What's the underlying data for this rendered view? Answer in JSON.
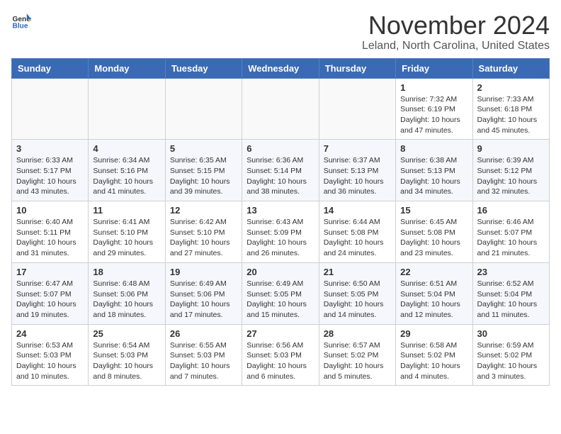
{
  "header": {
    "logo_general": "General",
    "logo_blue": "Blue",
    "month_year": "November 2024",
    "location": "Leland, North Carolina, United States"
  },
  "days_of_week": [
    "Sunday",
    "Monday",
    "Tuesday",
    "Wednesday",
    "Thursday",
    "Friday",
    "Saturday"
  ],
  "weeks": [
    [
      {
        "day": "",
        "info": ""
      },
      {
        "day": "",
        "info": ""
      },
      {
        "day": "",
        "info": ""
      },
      {
        "day": "",
        "info": ""
      },
      {
        "day": "",
        "info": ""
      },
      {
        "day": "1",
        "info": "Sunrise: 7:32 AM\nSunset: 6:19 PM\nDaylight: 10 hours and 47 minutes."
      },
      {
        "day": "2",
        "info": "Sunrise: 7:33 AM\nSunset: 6:18 PM\nDaylight: 10 hours and 45 minutes."
      }
    ],
    [
      {
        "day": "3",
        "info": "Sunrise: 6:33 AM\nSunset: 5:17 PM\nDaylight: 10 hours and 43 minutes."
      },
      {
        "day": "4",
        "info": "Sunrise: 6:34 AM\nSunset: 5:16 PM\nDaylight: 10 hours and 41 minutes."
      },
      {
        "day": "5",
        "info": "Sunrise: 6:35 AM\nSunset: 5:15 PM\nDaylight: 10 hours and 39 minutes."
      },
      {
        "day": "6",
        "info": "Sunrise: 6:36 AM\nSunset: 5:14 PM\nDaylight: 10 hours and 38 minutes."
      },
      {
        "day": "7",
        "info": "Sunrise: 6:37 AM\nSunset: 5:13 PM\nDaylight: 10 hours and 36 minutes."
      },
      {
        "day": "8",
        "info": "Sunrise: 6:38 AM\nSunset: 5:13 PM\nDaylight: 10 hours and 34 minutes."
      },
      {
        "day": "9",
        "info": "Sunrise: 6:39 AM\nSunset: 5:12 PM\nDaylight: 10 hours and 32 minutes."
      }
    ],
    [
      {
        "day": "10",
        "info": "Sunrise: 6:40 AM\nSunset: 5:11 PM\nDaylight: 10 hours and 31 minutes."
      },
      {
        "day": "11",
        "info": "Sunrise: 6:41 AM\nSunset: 5:10 PM\nDaylight: 10 hours and 29 minutes."
      },
      {
        "day": "12",
        "info": "Sunrise: 6:42 AM\nSunset: 5:10 PM\nDaylight: 10 hours and 27 minutes."
      },
      {
        "day": "13",
        "info": "Sunrise: 6:43 AM\nSunset: 5:09 PM\nDaylight: 10 hours and 26 minutes."
      },
      {
        "day": "14",
        "info": "Sunrise: 6:44 AM\nSunset: 5:08 PM\nDaylight: 10 hours and 24 minutes."
      },
      {
        "day": "15",
        "info": "Sunrise: 6:45 AM\nSunset: 5:08 PM\nDaylight: 10 hours and 23 minutes."
      },
      {
        "day": "16",
        "info": "Sunrise: 6:46 AM\nSunset: 5:07 PM\nDaylight: 10 hours and 21 minutes."
      }
    ],
    [
      {
        "day": "17",
        "info": "Sunrise: 6:47 AM\nSunset: 5:07 PM\nDaylight: 10 hours and 19 minutes."
      },
      {
        "day": "18",
        "info": "Sunrise: 6:48 AM\nSunset: 5:06 PM\nDaylight: 10 hours and 18 minutes."
      },
      {
        "day": "19",
        "info": "Sunrise: 6:49 AM\nSunset: 5:06 PM\nDaylight: 10 hours and 17 minutes."
      },
      {
        "day": "20",
        "info": "Sunrise: 6:49 AM\nSunset: 5:05 PM\nDaylight: 10 hours and 15 minutes."
      },
      {
        "day": "21",
        "info": "Sunrise: 6:50 AM\nSunset: 5:05 PM\nDaylight: 10 hours and 14 minutes."
      },
      {
        "day": "22",
        "info": "Sunrise: 6:51 AM\nSunset: 5:04 PM\nDaylight: 10 hours and 12 minutes."
      },
      {
        "day": "23",
        "info": "Sunrise: 6:52 AM\nSunset: 5:04 PM\nDaylight: 10 hours and 11 minutes."
      }
    ],
    [
      {
        "day": "24",
        "info": "Sunrise: 6:53 AM\nSunset: 5:03 PM\nDaylight: 10 hours and 10 minutes."
      },
      {
        "day": "25",
        "info": "Sunrise: 6:54 AM\nSunset: 5:03 PM\nDaylight: 10 hours and 8 minutes."
      },
      {
        "day": "26",
        "info": "Sunrise: 6:55 AM\nSunset: 5:03 PM\nDaylight: 10 hours and 7 minutes."
      },
      {
        "day": "27",
        "info": "Sunrise: 6:56 AM\nSunset: 5:03 PM\nDaylight: 10 hours and 6 minutes."
      },
      {
        "day": "28",
        "info": "Sunrise: 6:57 AM\nSunset: 5:02 PM\nDaylight: 10 hours and 5 minutes."
      },
      {
        "day": "29",
        "info": "Sunrise: 6:58 AM\nSunset: 5:02 PM\nDaylight: 10 hours and 4 minutes."
      },
      {
        "day": "30",
        "info": "Sunrise: 6:59 AM\nSunset: 5:02 PM\nDaylight: 10 hours and 3 minutes."
      }
    ]
  ]
}
